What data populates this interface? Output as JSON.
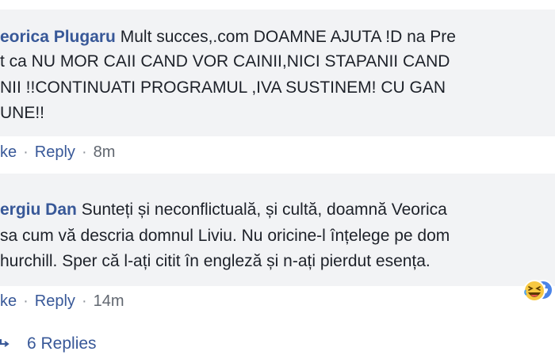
{
  "comments": [
    {
      "author": "eorica Plugaru",
      "lines": [
        " Mult succes,.com DOAMNE AJUTA !D na Pre",
        "t ca NU MOR CAII CAND VOR CAINII,NICI STAPANII CAND",
        "NII !!CONTINUATI PROGRAMUL ,IVA SUSTINEM! CU GAN",
        "UNE!!"
      ],
      "actions": {
        "like": "ke",
        "reply": "Reply",
        "separator": "·",
        "time": "8m"
      }
    },
    {
      "author": "ergiu Dan",
      "lines": [
        " Sunteți și neconflictuală, și cultă, doamnă Veorica",
        "sa cum vă descria domnul Liviu. Nu oricine-l înțelege pe dom",
        "hurchill. Sper că l-ați citit în engleză și n-ați pierdut esența."
      ],
      "actions": {
        "like": "ke",
        "reply": "Reply",
        "separator": "·",
        "time": "14m"
      },
      "reaction_icons": [
        "haha-icon",
        "like-icon"
      ]
    }
  ],
  "view_replies": {
    "icon": "reply-arrow-icon",
    "label": "6 Replies"
  },
  "colors": {
    "author": "#385898",
    "text": "#1d2129",
    "bubble": "#f2f3f5",
    "meta": "#616770"
  }
}
